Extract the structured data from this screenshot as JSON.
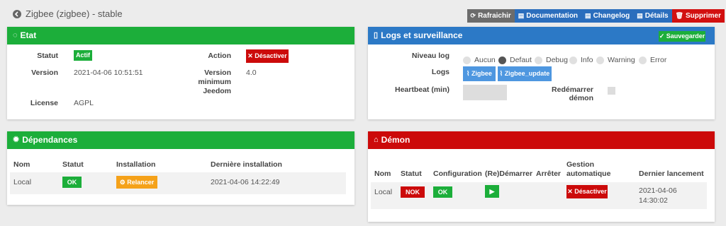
{
  "header": {
    "title": "Zigbee (zigbee) - stable",
    "buttons": {
      "refresh": "Rafraichir",
      "documentation": "Documentation",
      "changelog": "Changelog",
      "details": "Détails",
      "delete": "Supprimer"
    }
  },
  "etat": {
    "title": "Etat",
    "statut_label": "Statut",
    "statut_value": "Actif",
    "action_label": "Action",
    "action_button": "Désactiver",
    "version_label": "Version",
    "version_value": "2021-04-06 10:51:51",
    "version_min_label_1": "Version",
    "version_min_label_2": "minimum",
    "version_min_label_3": "Jeedom",
    "version_min_value": "4.0",
    "license_label": "License",
    "license_value": "AGPL"
  },
  "dependances": {
    "title": "Dépendances",
    "headers": [
      "Nom",
      "Statut",
      "Installation",
      "Dernière installation"
    ],
    "row": {
      "nom": "Local",
      "statut": "OK",
      "installation": "Relancer",
      "derniere": "2021-04-06 14:22:49"
    }
  },
  "logs": {
    "title": "Logs et surveillance",
    "save_button": "Sauvegarder",
    "niveau_label": "Niveau log",
    "levels": [
      "Aucun",
      "Defaut",
      "Debug",
      "Info",
      "Warning",
      "Error"
    ],
    "selected_level": "Defaut",
    "logs_label": "Logs",
    "log_buttons": [
      "Zigbee",
      "Zigbee_update"
    ],
    "heartbeat_label": "Heartbeat (min)",
    "heartbeat_value": "",
    "restart_label": "Redémarrer démon"
  },
  "demon": {
    "title": "Démon",
    "headers": {
      "nom": "Nom",
      "statut": "Statut",
      "configuration": "Configuration",
      "redemarrer": "(Re)Démarrer",
      "arreter": "Arrêter",
      "gestion_1": "Gestion",
      "gestion_2": "automatique",
      "dernier": "Dernier lancement"
    },
    "row": {
      "nom": "Local",
      "statut": "NOK",
      "configuration": "OK",
      "gestion": "Désactiver",
      "dernier_1": "2021-04-06",
      "dernier_2": "14:30:02"
    }
  },
  "colors": {
    "green": "#1cae3a",
    "blue": "#2c79c6",
    "red": "#cc0a0a",
    "orange": "#f5a21a",
    "grey_button": "#6c6c6c"
  }
}
